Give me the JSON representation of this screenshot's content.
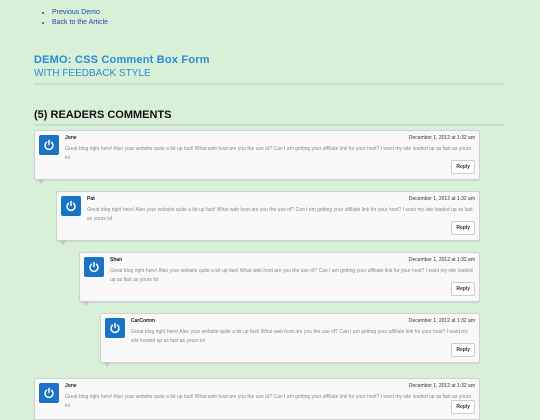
{
  "nav": {
    "items": [
      "Previous Demo",
      "Back to the Article"
    ]
  },
  "header": {
    "title": "DEMO: CSS Comment Box Form",
    "subtitle": "WITH FEEDBACK STYLE"
  },
  "comments_section": {
    "heading": "(5) READERS COMMENTS"
  },
  "comments": [
    {
      "author": "Jone",
      "date": "December 1, 2012 at 1:32 am",
      "text": "Great blog right here! Also your website quite a bit up fast! What web host are you the use of? Can I am getting your affiliate link for your host? I want my site loaded up as fast as yours lol",
      "reply": "Reply"
    },
    {
      "author": "Pat",
      "date": "December 1, 2012 at 1:32 am",
      "text": "Great blog right here! Also your website quite a bit up fast! What web host are you the use of? Can I am getting your affiliate link for your host? I want my site loaded up as fast as yours lol",
      "reply": "Reply"
    },
    {
      "author": "Shan",
      "date": "December 1, 2012 at 1:32 am",
      "text": "Great blog right here! Also your website quite a bit up fast! What web host are you the use of? Can I am getting your affiliate link for your host? I want my site loaded up as fast as yours lol",
      "reply": "Reply"
    },
    {
      "author": "CarComm",
      "date": "December 1, 2012 at 1:32 am",
      "text": "Great blog right here! Also your website quite a bit up fast! What web host are you the use of? Can I am getting your affiliate link for your host? I want my site loaded up as fast as yours lol",
      "reply": "Reply"
    },
    {
      "author": "Jone",
      "date": "December 1, 2012 at 1:32 am",
      "text": "Great blog right here! Also your website quite a bit up fast! What web host are you the use of? Can I am getting your affiliate link for your host? I want my site loaded up as fast as yours lol",
      "reply": "Reply"
    }
  ],
  "colors": {
    "background": "#d8f0d8",
    "accent": "#2a8bd8",
    "avatar": "#1a73c4",
    "link": "#1f4fa0"
  },
  "icons": {
    "avatar": "power-icon"
  }
}
